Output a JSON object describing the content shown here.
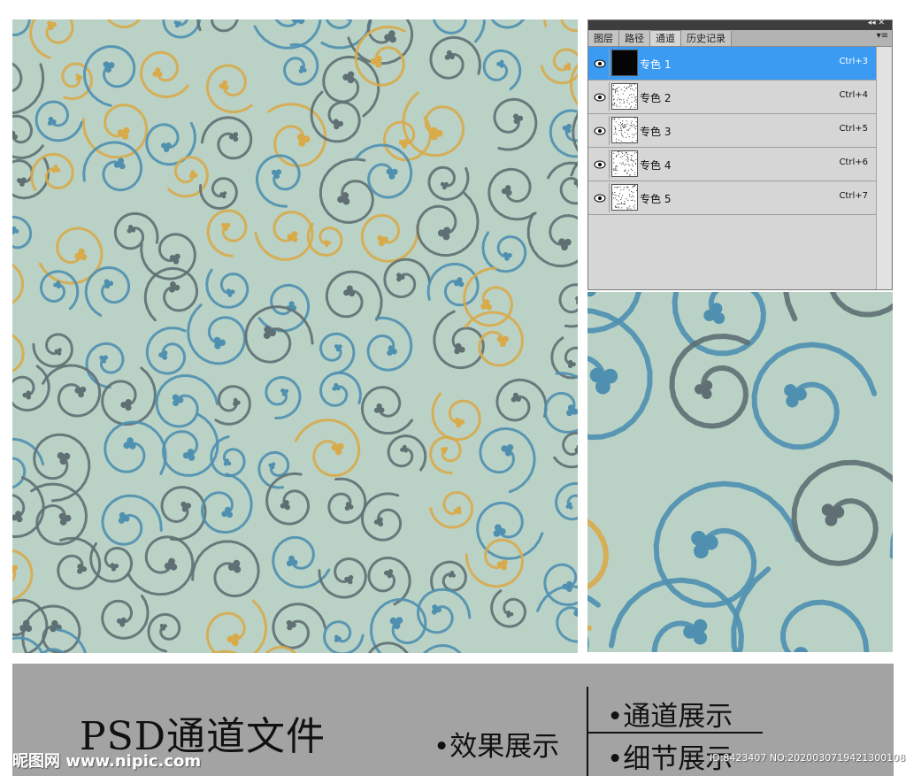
{
  "panel": {
    "tabs": [
      "图层",
      "路径",
      "通道",
      "历史记录"
    ],
    "active_tab": 2,
    "menu_icon": "panel-menu-icon",
    "collapse_icon": "double-chevron-icon",
    "channels": [
      {
        "name": "专色 1",
        "shortcut": "Ctrl+3",
        "selected": true
      },
      {
        "name": "专色 2",
        "shortcut": "Ctrl+4",
        "selected": false
      },
      {
        "name": "专色 3",
        "shortcut": "Ctrl+5",
        "selected": false
      },
      {
        "name": "专色 4",
        "shortcut": "Ctrl+6",
        "selected": false
      },
      {
        "name": "专色 5",
        "shortcut": "Ctrl+7",
        "selected": false
      }
    ]
  },
  "banner": {
    "title": "PSD通道文件",
    "effect": "•效果展示",
    "channel": "•通道展示",
    "detail": "•细节展示",
    "watermark_logo": "昵图网 www.nipic.com",
    "watermark_id": "ID:8423407 NO:20200307194213001086"
  },
  "colors": {
    "pattern_bg": "#b9d2c5",
    "blue": "#4f8fb0",
    "gray": "#5f6f73",
    "gold": "#d8aa4a",
    "selection": "#3b9bf3"
  }
}
